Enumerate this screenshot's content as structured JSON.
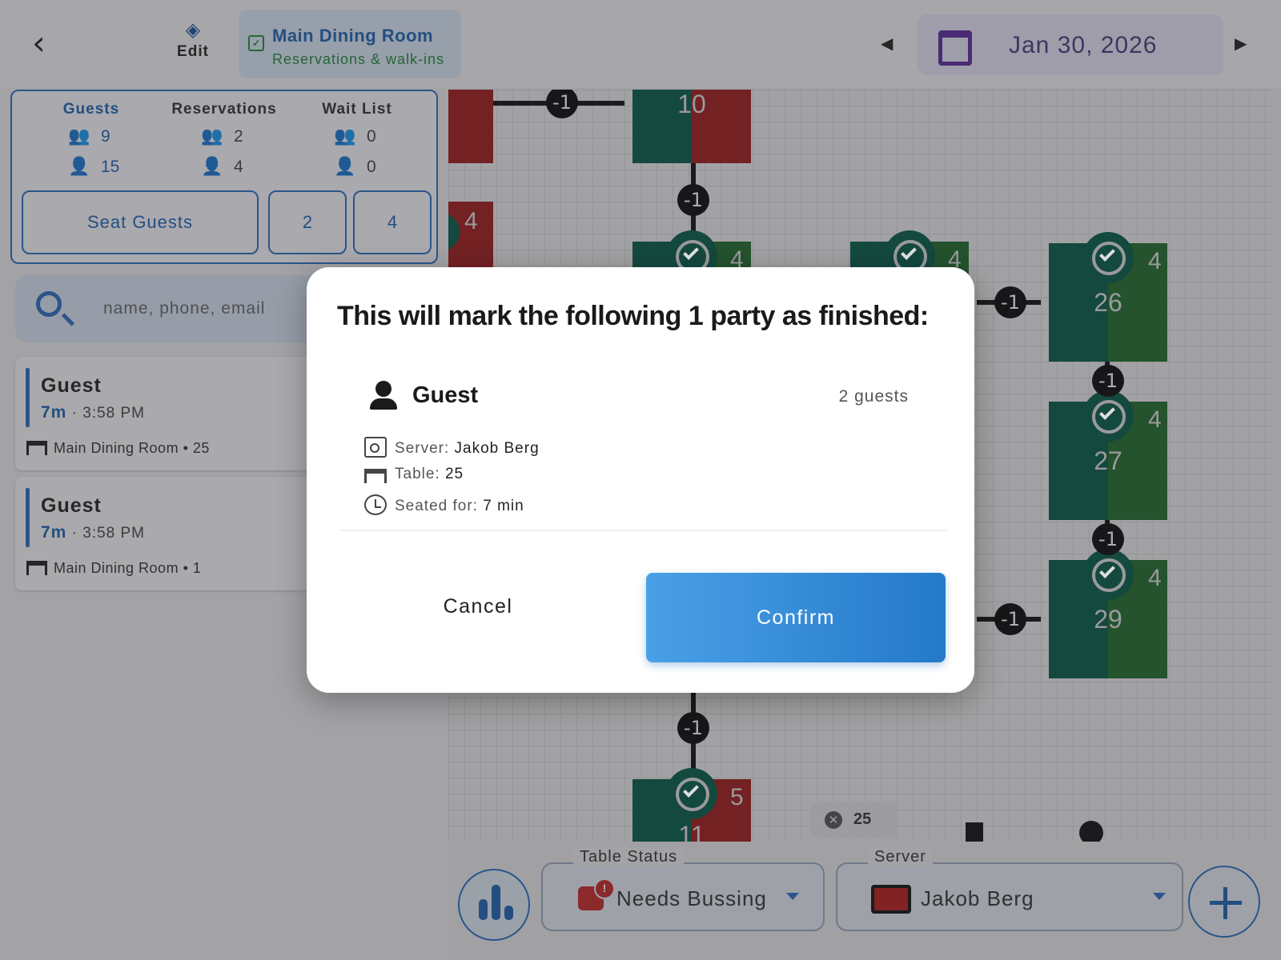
{
  "header": {
    "edit_label": "Edit",
    "room_title": "Main Dining Room",
    "room_subtitle": "Reservations & walk-ins",
    "date": "Jan 30, 2026"
  },
  "stats": {
    "guests": {
      "label": "Guests",
      "parties": "9",
      "people": "15"
    },
    "reservations": {
      "label": "Reservations",
      "parties": "2",
      "people": "4"
    },
    "waitlist": {
      "label": "Wait List",
      "parties": "0",
      "people": "0"
    }
  },
  "actions": {
    "seat_guests": "Seat Guests",
    "count_a": "2",
    "count_b": "4"
  },
  "search": {
    "placeholder": "name, phone, email"
  },
  "parties": [
    {
      "name": "Guest",
      "duration": "7m",
      "time": "3:58 PM",
      "room": "Main Dining Room",
      "table": "25"
    },
    {
      "name": "Guest",
      "duration": "7m",
      "time": "3:58 PM",
      "room": "Main Dining Room",
      "table": "1"
    }
  ],
  "floor": {
    "tables": [
      {
        "number": "10",
        "colors": [
          "#065b47",
          "#9e1b1b"
        ]
      },
      {
        "number": "26",
        "seats": "4",
        "colors": [
          "#065b47",
          "#1f6b2a"
        ]
      },
      {
        "number": "27",
        "seats": "4",
        "colors": [
          "#065b47",
          "#1f6b2a"
        ]
      },
      {
        "number": "29",
        "seats": "4",
        "colors": [
          "#065b47",
          "#1f6b2a"
        ]
      },
      {
        "number": "11",
        "seats": "5",
        "colors": [
          "#065b47",
          "#9e1b1b"
        ]
      }
    ],
    "partial_seat_labels": [
      "4",
      "4",
      "4"
    ],
    "link_label": "-1",
    "selected_chip": "25"
  },
  "toolbar": {
    "table_status_label": "Table Status",
    "table_status_value": "Needs Bussing",
    "server_label": "Server",
    "server_value": "Jakob Berg",
    "server_color": "#b71c1c"
  },
  "dialog": {
    "title": "This will mark the following 1 party as finished:",
    "party_name": "Guest",
    "party_count": "2 guests",
    "server_label": "Server:",
    "server_value": "Jakob Berg",
    "table_label": "Table:",
    "table_value": "25",
    "seated_label": "Seated for:",
    "seated_value": "7 min",
    "cancel": "Cancel",
    "confirm": "Confirm"
  },
  "colors": {
    "accent": "#2a6fc0",
    "confirm": "#2f8ad8",
    "seated_green": "#065b47",
    "occupied_red": "#9e1b1b"
  }
}
